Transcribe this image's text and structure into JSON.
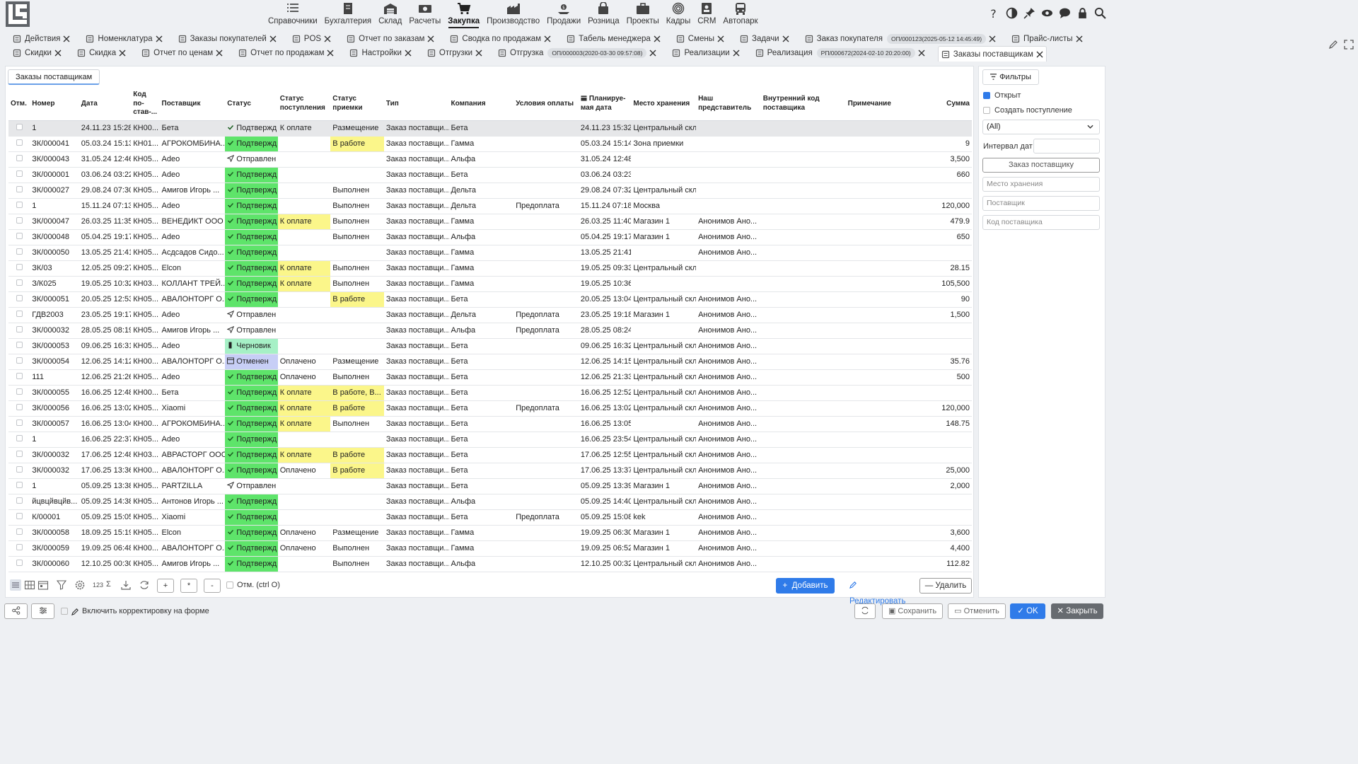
{
  "nav": [
    {
      "label": "Справочники",
      "icon": "list-icon"
    },
    {
      "label": "Бухгалтерия",
      "icon": "ledger-icon"
    },
    {
      "label": "Склад",
      "icon": "warehouse-icon"
    },
    {
      "label": "Расчеты",
      "icon": "money-icon"
    },
    {
      "label": "Закупка",
      "icon": "cart-icon"
    },
    {
      "label": "Производство",
      "icon": "factory-icon"
    },
    {
      "label": "Продажи",
      "icon": "sales-icon"
    },
    {
      "label": "Розница",
      "icon": "bag-icon"
    },
    {
      "label": "Проекты",
      "icon": "briefcase-icon"
    },
    {
      "label": "Кадры",
      "icon": "fingerprint-icon"
    },
    {
      "label": "CRM",
      "icon": "crm-icon"
    },
    {
      "label": "Автопарк",
      "icon": "bus-icon"
    }
  ],
  "nav_active": "Закупка",
  "tabs_row1": [
    {
      "label": "Действия"
    },
    {
      "label": "Номенклатура"
    },
    {
      "label": "Заказы покупателей"
    },
    {
      "label": "POS"
    },
    {
      "label": "Отчет по заказам"
    },
    {
      "label": "Сводка по продажам"
    },
    {
      "label": "Табель менеджера"
    },
    {
      "label": "Смены"
    },
    {
      "label": "Задачи"
    },
    {
      "label": "Заказ покупателя",
      "doc": "ОП/000123(2025-05-12 14:45:49)"
    },
    {
      "label": "Прайс-листы"
    }
  ],
  "tabs_row2": [
    {
      "label": "Скидки"
    },
    {
      "label": "Скидка"
    },
    {
      "label": "Отчет по ценам"
    },
    {
      "label": "Отчет по продажам"
    },
    {
      "label": "Настройки"
    },
    {
      "label": "Отгрузки"
    },
    {
      "label": "Отгрузка",
      "doc": "ОП/000003(2020-03-30 09:57:08)"
    },
    {
      "label": "Реализации"
    },
    {
      "label": "Реализация",
      "doc": "РП/000672(2024-02-10 20:20:00)"
    },
    {
      "label": "Заказы поставщикам",
      "active": true
    }
  ],
  "subtab": "Заказы поставщикам",
  "columns": [
    "Отм.",
    "Номер",
    "Дата",
    "Код по-став-...",
    "Поставщик",
    "Статус",
    "Статус поступления",
    "Статус приемки",
    "Тип",
    "Компания",
    "Условия оплаты",
    "Планируе-мая дата",
    "Место хранения",
    "Наш представитель",
    "Внутренний код поставщика",
    "Примечание",
    "Сумма"
  ],
  "rows": [
    {
      "num": "1",
      "date": "24.11.23 15:28",
      "code": "КН00...",
      "supplier": "Бета",
      "status": "Подтвержд",
      "status_kind": "ok",
      "receipt": "К оплате",
      "accept": "Размещение",
      "type": "Заказ поставщи...",
      "company": "Бета",
      "pay": "",
      "plan": "24.11.23 15:32",
      "store": "Центральный скла",
      "rep": "",
      "sum": "",
      "selected": true
    },
    {
      "num": "ЗК/000041",
      "date": "05.03.24 15:13",
      "code": "КН01...",
      "supplier": "АГРОКОМБИНА...",
      "status": "Подтвержд",
      "status_kind": "ok",
      "receipt": "",
      "accept": "В работе",
      "type": "Заказ поставщи...",
      "company": "Гамма",
      "pay": "",
      "plan": "05.03.24 15:14",
      "store": "Зона приемки",
      "rep": "",
      "sum": "9"
    },
    {
      "num": "ЗК/000043",
      "date": "31.05.24 12:46",
      "code": "КН05...",
      "supplier": "Adeo",
      "status": "Отправлен",
      "status_kind": "sent",
      "receipt": "",
      "accept": "",
      "type": "Заказ поставщи...",
      "company": "Альфа",
      "pay": "",
      "plan": "31.05.24 12:48",
      "store": "",
      "rep": "",
      "sum": "3,500"
    },
    {
      "num": "ЗК/000001",
      "date": "03.06.24 03:22",
      "code": "КН05...",
      "supplier": "Adeo",
      "status": "Подтвержд",
      "status_kind": "ok",
      "receipt": "",
      "accept": "",
      "type": "Заказ поставщи...",
      "company": "Бета",
      "pay": "",
      "plan": "03.06.24 03:23",
      "store": "",
      "rep": "",
      "sum": "660"
    },
    {
      "num": "ЗК/000027",
      "date": "29.08.24 07:30",
      "code": "КН05...",
      "supplier": "Амигов Игорь ...",
      "status": "Подтвержд",
      "status_kind": "ok",
      "receipt": "",
      "accept": "Выполнен",
      "type": "Заказ поставщи...",
      "company": "Дельта",
      "pay": "",
      "plan": "29.08.24 07:32",
      "store": "Центральный скла",
      "rep": "",
      "sum": ""
    },
    {
      "num": "1",
      "date": "15.11.24 07:13",
      "code": "КН05...",
      "supplier": "Adeo",
      "status": "Подтвержд",
      "status_kind": "ok",
      "receipt": "",
      "accept": "Выполнен",
      "type": "Заказ поставщи...",
      "company": "Дельта",
      "pay": "Предоплата",
      "plan": "15.11.24 07:18",
      "store": "Москва",
      "rep": "",
      "sum": "120,000"
    },
    {
      "num": "ЗК/000047",
      "date": "26.03.25 11:35",
      "code": "КН05...",
      "supplier": "ВЕНЕДИКТ ООО",
      "status": "Подтвержд",
      "status_kind": "ok",
      "receipt": "К оплате",
      "accept": "Выполнен",
      "type": "Заказ поставщи...",
      "company": "Гамма",
      "pay": "",
      "plan": "26.03.25 11:40",
      "store": "Магазин 1",
      "rep": "Анонимов Ано...",
      "sum": "479.9"
    },
    {
      "num": "ЗК/000048",
      "date": "05.04.25 19:17",
      "code": "КН05...",
      "supplier": "Adeo",
      "status": "Подтвержд",
      "status_kind": "ok",
      "receipt": "",
      "accept": "Выполнен",
      "type": "Заказ поставщи...",
      "company": "Альфа",
      "pay": "",
      "plan": "05.04.25 19:17",
      "store": "Магазин 1",
      "rep": "Анонимов Ано...",
      "sum": "650"
    },
    {
      "num": "ЗК/000050",
      "date": "13.05.25 21:41",
      "code": "КН05...",
      "supplier": "Асдсадов Сидо...",
      "status": "Подтвержд",
      "status_kind": "ok",
      "receipt": "",
      "accept": "",
      "type": "Заказ поставщи...",
      "company": "Гамма",
      "pay": "",
      "plan": "13.05.25 21:41",
      "store": "",
      "rep": "Анонимов Ано...",
      "sum": ""
    },
    {
      "num": "ЗК/03",
      "date": "12.05.25 09:27",
      "code": "КН05...",
      "supplier": "Elcon",
      "status": "Подтвержд",
      "status_kind": "ok",
      "receipt": "К оплате",
      "accept": "Выполнен",
      "type": "Заказ поставщи...",
      "company": "Гамма",
      "pay": "",
      "plan": "19.05.25 09:33",
      "store": "Центральный скла",
      "rep": "",
      "sum": "28.15"
    },
    {
      "num": "З/К025",
      "date": "19.05.25 10:32",
      "code": "КН03...",
      "supplier": "КОЛЛАНТ ТРЕЙ...",
      "status": "Подтвержд",
      "status_kind": "ok",
      "receipt": "К оплате",
      "accept": "Выполнен",
      "type": "Заказ поставщи...",
      "company": "Гамма",
      "pay": "",
      "plan": "19.05.25 10:36",
      "store": "",
      "rep": "",
      "sum": "105,500"
    },
    {
      "num": "ЗК/000051",
      "date": "20.05.25 12:53",
      "code": "КН05...",
      "supplier": "АВАЛОНТОРГ О...",
      "status": "Подтвержд",
      "status_kind": "ok",
      "receipt": "",
      "accept": "В работе",
      "type": "Заказ поставщи...",
      "company": "Бета",
      "pay": "",
      "plan": "20.05.25 13:04",
      "store": "Центральный скла",
      "rep": "Анонимов Ано...",
      "sum": "90"
    },
    {
      "num": "ГДВ2003",
      "date": "23.05.25 19:17",
      "code": "КН05...",
      "supplier": "Adeo",
      "status": "Отправлен",
      "status_kind": "sent",
      "receipt": "",
      "accept": "",
      "type": "Заказ поставщи...",
      "company": "Дельта",
      "pay": "Предоплата",
      "plan": "23.05.25 19:18",
      "store": "Магазин 1",
      "rep": "Анонимов Ано...",
      "sum": "1,500"
    },
    {
      "num": "ЗК/000032",
      "date": "28.05.25 08:19",
      "code": "КН05...",
      "supplier": "Амигов Игорь ...",
      "status": "Отправлен",
      "status_kind": "sent",
      "receipt": "",
      "accept": "",
      "type": "Заказ поставщи...",
      "company": "Альфа",
      "pay": "Предоплата",
      "plan": "28.05.25 08:24",
      "store": "",
      "rep": "Анонимов Ано...",
      "sum": ""
    },
    {
      "num": "ЗК/000053",
      "date": "09.06.25 16:31",
      "code": "КН05...",
      "supplier": "Adeo",
      "status": "Черновик",
      "status_kind": "draft",
      "receipt": "",
      "accept": "",
      "type": "Заказ поставщи...",
      "company": "Бета",
      "pay": "",
      "plan": "09.06.25 16:32",
      "store": "Центральный скла",
      "rep": "Анонимов Ано...",
      "sum": ""
    },
    {
      "num": "ЗК/000054",
      "date": "12.06.25 14:12",
      "code": "КН00...",
      "supplier": "АВАЛОНТОРГ О...",
      "status": "Отменен",
      "status_kind": "cancel",
      "receipt": "Оплачено",
      "accept": "Размещение",
      "type": "Заказ поставщи...",
      "company": "Бета",
      "pay": "",
      "plan": "12.06.25 14:15",
      "store": "Центральный скла",
      "rep": "Анонимов Ано...",
      "sum": "35.76"
    },
    {
      "num": "111",
      "date": "12.06.25 21:26",
      "code": "КН05...",
      "supplier": "Adeo",
      "status": "Подтвержд",
      "status_kind": "ok",
      "receipt": "Оплачено",
      "accept": "Выполнен",
      "type": "Заказ поставщи...",
      "company": "Бета",
      "pay": "",
      "plan": "12.06.25 21:33",
      "store": "Центральный скла",
      "rep": "Анонимов Ано...",
      "sum": "500"
    },
    {
      "num": "ЗК/000055",
      "date": "16.06.25 12:48",
      "code": "КН00...",
      "supplier": "Бета",
      "status": "Подтвержд",
      "status_kind": "ok",
      "receipt": "К оплате",
      "accept": "В работе, В...",
      "type": "Заказ поставщи...",
      "company": "Бета",
      "pay": "",
      "plan": "16.06.25 12:52",
      "store": "Центральный скла",
      "rep": "Анонимов Ано...",
      "sum": ""
    },
    {
      "num": "ЗК/000056",
      "date": "16.06.25 13:02",
      "code": "КН05...",
      "supplier": "Xiaomi",
      "status": "Подтвержд",
      "status_kind": "ok",
      "receipt": "К оплате",
      "accept": "В работе",
      "type": "Заказ поставщи...",
      "company": "Бета",
      "pay": "Предоплата",
      "plan": "16.06.25 13:02",
      "store": "Центральный скла",
      "rep": "Анонимов Ано...",
      "sum": "120,000"
    },
    {
      "num": "ЗК/000057",
      "date": "16.06.25 13:04",
      "code": "КН00...",
      "supplier": "АГРОКОМБИНА...",
      "status": "Подтвержд",
      "status_kind": "ok",
      "receipt": "К оплате",
      "accept": "Выполнен",
      "type": "Заказ поставщи...",
      "company": "Бета",
      "pay": "",
      "plan": "16.06.25 13:05",
      "store": "",
      "rep": "Анонимов Ано...",
      "sum": "148.75"
    },
    {
      "num": "1",
      "date": "16.06.25 22:37",
      "code": "КН05...",
      "supplier": "Adeo",
      "status": "Подтвержд",
      "status_kind": "ok",
      "receipt": "",
      "accept": "",
      "type": "Заказ поставщи...",
      "company": "Бета",
      "pay": "",
      "plan": "16.06.25 23:54",
      "store": "Центральный скла",
      "rep": "Анонимов Ано...",
      "sum": ""
    },
    {
      "num": "ЗК/000032",
      "date": "17.06.25 12:48",
      "code": "КН03...",
      "supplier": "АВРАСТОРГ ООО",
      "status": "Подтвержд",
      "status_kind": "ok",
      "receipt": "К оплате",
      "accept": "В работе",
      "type": "Заказ поставщи...",
      "company": "Бета",
      "pay": "",
      "plan": "17.06.25 12:55",
      "store": "Центральный скла",
      "rep": "Анонимов Ано...",
      "sum": ""
    },
    {
      "num": "ЗК/000032",
      "date": "17.06.25 13:36",
      "code": "КН00...",
      "supplier": "АВАЛОНТОРГ О...",
      "status": "Подтвержд",
      "status_kind": "ok",
      "receipt": "Оплачено",
      "accept": "В работе",
      "type": "Заказ поставщи...",
      "company": "Бета",
      "pay": "",
      "plan": "17.06.25 13:37",
      "store": "Центральный скла",
      "rep": "Анонимов Ано...",
      "sum": "25,000"
    },
    {
      "num": "1",
      "date": "05.09.25 13:38",
      "code": "КН05...",
      "supplier": "PARTZILLA",
      "status": "Отправлен",
      "status_kind": "sent",
      "receipt": "",
      "accept": "",
      "type": "Заказ поставщи...",
      "company": "Бета",
      "pay": "",
      "plan": "05.09.25 13:39",
      "store": "Магазин 1",
      "rep": "Анонимов Ано...",
      "sum": "2,000"
    },
    {
      "num": "йцвцйвцйв...",
      "date": "05.09.25 14:38",
      "code": "КН05...",
      "supplier": "Антонов Игорь ...",
      "status": "Подтвержд",
      "status_kind": "ok",
      "receipt": "",
      "accept": "",
      "type": "Заказ поставщи...",
      "company": "Альфа",
      "pay": "",
      "plan": "05.09.25 14:40",
      "store": "Центральный скла",
      "rep": "Анонимов Ано...",
      "sum": ""
    },
    {
      "num": "К/00001",
      "date": "05.09.25 15:05",
      "code": "КН05...",
      "supplier": "Xiaomi",
      "status": "Подтвержд",
      "status_kind": "ok",
      "receipt": "",
      "accept": "",
      "type": "Заказ поставщи...",
      "company": "Бета",
      "pay": "Предоплата",
      "plan": "05.09.25 15:08",
      "store": "kek",
      "rep": "Анонимов Ано...",
      "sum": ""
    },
    {
      "num": "ЗК/000058",
      "date": "18.09.25 15:19",
      "code": "КН05...",
      "supplier": "Elcon",
      "status": "Подтвержд",
      "status_kind": "ok",
      "receipt": "Оплачено",
      "accept": "Размещение",
      "type": "Заказ поставщи...",
      "company": "Гамма",
      "pay": "",
      "plan": "19.09.25 06:30",
      "store": "Магазин 1",
      "rep": "Анонимов Ано...",
      "sum": "3,600"
    },
    {
      "num": "ЗК/000059",
      "date": "19.09.25 06:48",
      "code": "КН00...",
      "supplier": "АВАЛОНТОРГ О...",
      "status": "Подтвержд",
      "status_kind": "ok",
      "receipt": "Оплачено",
      "accept": "Выполнен",
      "type": "Заказ поставщи...",
      "company": "Гамма",
      "pay": "",
      "plan": "19.09.25 06:52",
      "store": "Магазин 1",
      "rep": "Анонимов Ано...",
      "sum": "4,400"
    },
    {
      "num": "ЗК/000060",
      "date": "12.10.25 00:30",
      "code": "КН05...",
      "supplier": "Амигов Игорь ...",
      "status": "Подтвержд",
      "status_kind": "ok",
      "receipt": "",
      "accept": "Выполнен",
      "type": "Заказ поставщи...",
      "company": "Альфа",
      "pay": "",
      "plan": "12.10.25 00:32",
      "store": "Центральный скла",
      "rep": "Анонимов Ано...",
      "sum": "112.82"
    }
  ],
  "bottom": {
    "count_label": "123",
    "sum_label": "Σ",
    "plus": "+",
    "star": "*",
    "minus": "-",
    "mark_label": "Отм. (ctrl O)",
    "add": "Добавить",
    "edit": "Редактировать",
    "delete": "Удалить"
  },
  "filters": {
    "tab": "Фильтры",
    "open_label": "Открыт",
    "open_checked": true,
    "create_receipt_label": "Создать поступление",
    "create_checked": false,
    "select_value": "(All)",
    "date_interval": "Интервал дат",
    "order_button": "Заказ поставщику",
    "store_placeholder": "Место хранения",
    "supplier_placeholder": "Поставщик",
    "code_placeholder": "Код поставщика"
  },
  "footer": {
    "correct_label": "Включить корректировку на форме",
    "save": "Сохранить",
    "cancel": "Отменить",
    "ok": "OK",
    "close": "Закрыть"
  },
  "colors": {
    "status_ok": "#5ee46a",
    "status_draft": "#a6f0c6",
    "status_cancel": "#c7cef6",
    "receipt_highlight": "#fbf68a",
    "accent": "#2f7be9"
  }
}
